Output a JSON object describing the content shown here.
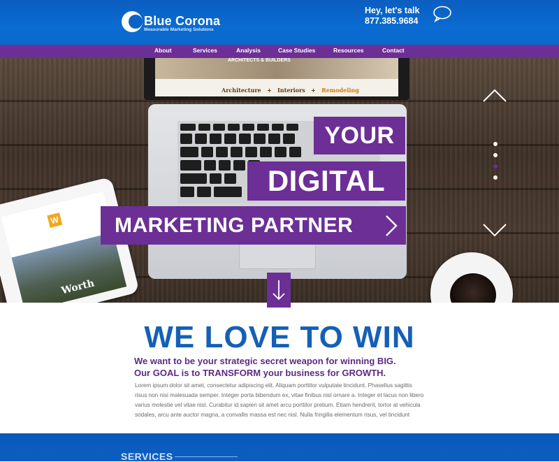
{
  "header": {
    "brand": "Blue Corona",
    "tagline": "Measurable Marketing Solutions",
    "contact_line1": "Hey, let's talk",
    "contact_phone": "877.385.9684",
    "accent_color": "#0a63c7"
  },
  "nav": {
    "items": [
      {
        "label": "About"
      },
      {
        "label": "Services"
      },
      {
        "label": "Analysis"
      },
      {
        "label": "Case Studies"
      },
      {
        "label": "Resources"
      },
      {
        "label": "Contact"
      }
    ],
    "color": "#6c2f96"
  },
  "hero": {
    "screen_label": "ARCHITECTS & BUILDERS",
    "screen_links": [
      "Architecture",
      "Interiors",
      "Remodeling"
    ],
    "tablet_word": "Worth",
    "tag_your": "YOUR",
    "tag_digital": "DIGITAL",
    "tag_marketing": "MARKETING PARTNER",
    "slider_active_index": 2,
    "slider_count": 4
  },
  "content": {
    "headline": "WE LOVE TO WIN",
    "sub_line1": "We want to be your strategic secret weapon for winning BIG.",
    "sub_line2": "Our GOAL is to TRANSFORM your business for GROWTH.",
    "body": "Lorem ipsum dolor sit amet, consectetur adipiscing elit. Aliquam porttitor vulputate tincidunt. Phasellus sagittis risus non nisi malesuada semper. Integer porta bibendum ex, vitae finibus nisl ornare a. Integer et lacus non libero varius molestie vel vitae nisl. Curabitur id sapien sit amet arcu porttitor pretium. Etiam hendrerit, tortor at vehicula sodales, arcu ante auctor magna, a convallis massa est nec nisl. Nulla fringilla elementum risus, vel tincidunt"
  },
  "footer": {
    "section_title": "SERVICES"
  }
}
